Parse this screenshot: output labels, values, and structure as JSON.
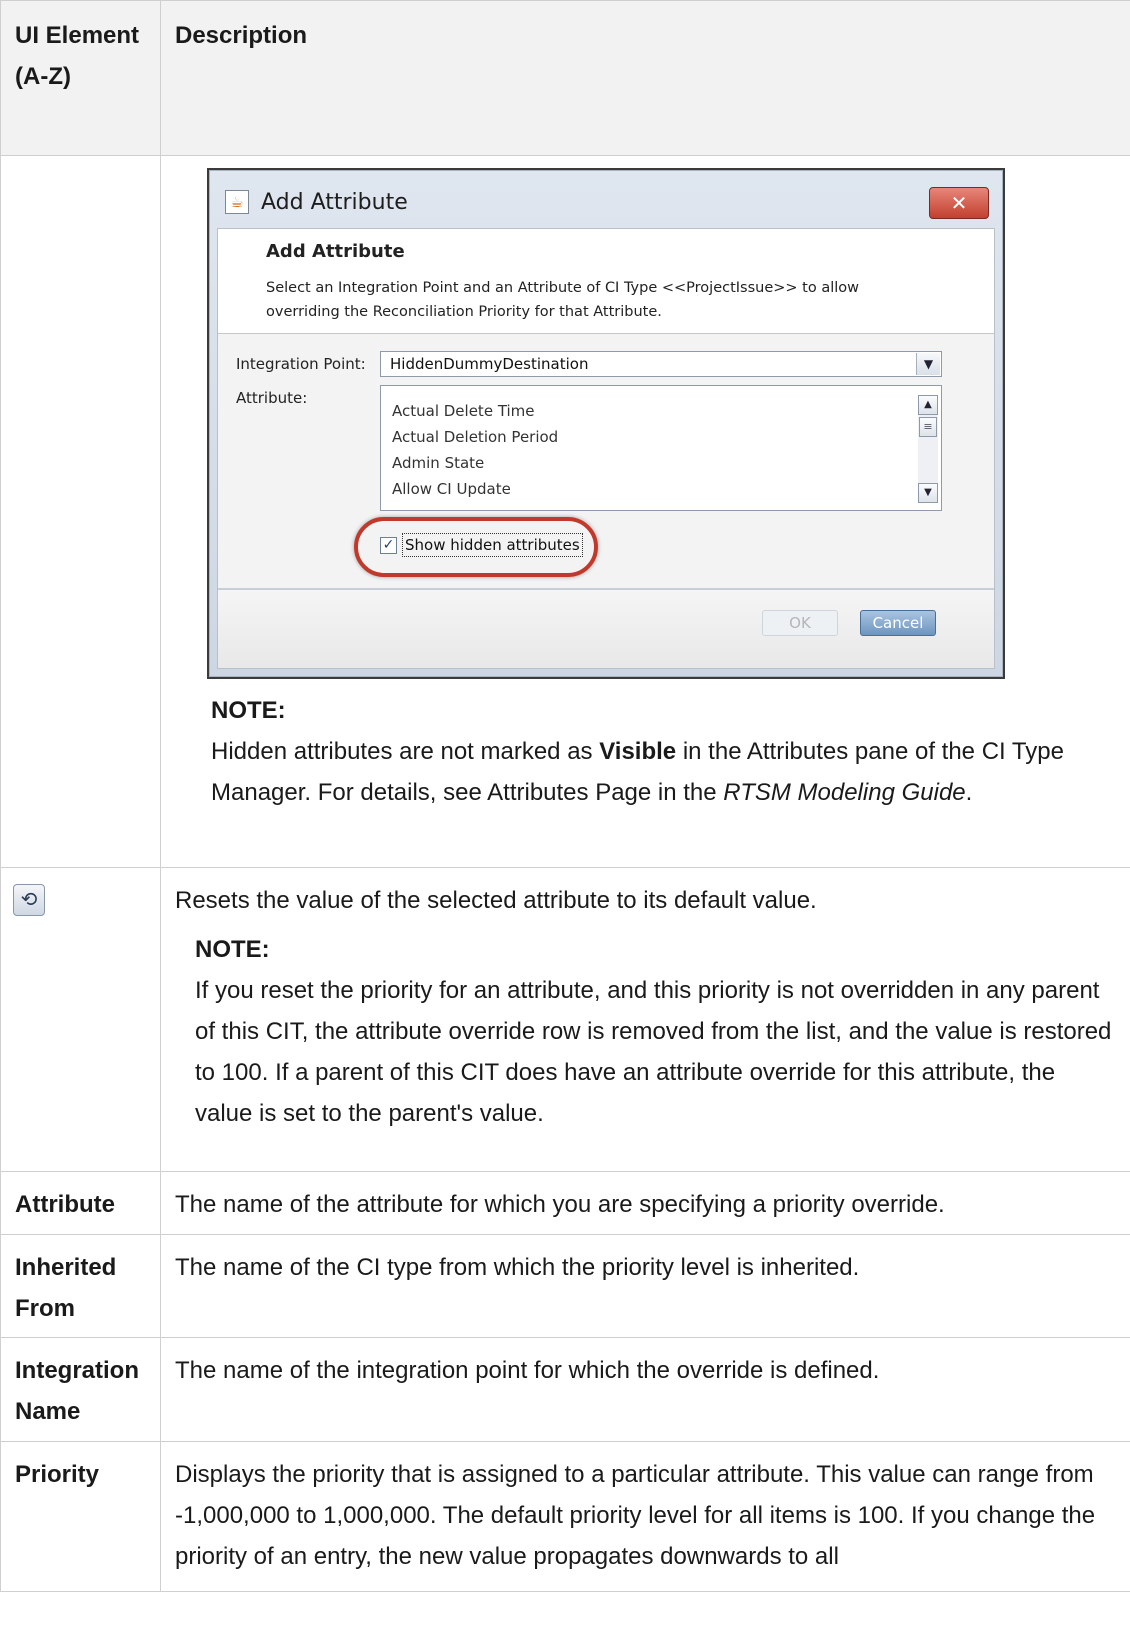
{
  "table": {
    "header": {
      "col1": "UI Element (A-Z)",
      "col2": "Description"
    }
  },
  "dialog": {
    "title": "Add Attribute",
    "close_label": "✕",
    "banner_title": "Add Attribute",
    "banner_text": "Select an Integration Point and an Attribute of CI Type <<ProjectIssue>> to allow overriding the Reconciliation Priority for that Attribute.",
    "integration_point_label": "Integration Point:",
    "integration_point_value": "HiddenDummyDestination",
    "attribute_label": "Attribute:",
    "attributes": [
      "Actual Delete Time",
      "Actual Deletion Period",
      "Admin State",
      "Allow CI Update"
    ],
    "show_hidden_label": "Show hidden attributes",
    "show_hidden_checked": true,
    "ok_label": "OK",
    "cancel_label": "Cancel"
  },
  "note1": {
    "heading": "NOTE:",
    "text_before_bold": "Hidden attributes are not marked as ",
    "bold": "Visible",
    "text_mid": " in the Attributes pane of the CI Type Manager. For details, see Attributes Page in the ",
    "italic_1": "RTSM Modeling",
    "italic_2": "Guide",
    "text_end": "."
  },
  "rows": [
    {
      "label": "",
      "icon": "reset-icon",
      "description": "Resets the value of the selected attribute to its default value.",
      "note_heading": "NOTE:",
      "note_text": "If you reset the priority for an attribute, and this priority is not overridden in any parent of this CIT, the attribute override row is removed from the list, and the value is restored to 100. If a parent of this CIT does have an attribute override for this attribute, the value is set to the parent's value."
    },
    {
      "label": "Attribute",
      "description": "The name of the attribute for which you are specifying a priority override."
    },
    {
      "label": "Inherited From",
      "description": "The name of the CI type from which the priority level is inherited."
    },
    {
      "label": "Integration Name",
      "description": "The name of the integration point for which the override is defined."
    },
    {
      "label": "Priority",
      "description": "Displays the priority that is assigned to a particular attribute. This value can range from -1,000,000 to 1,000,000. The default priority level for all items is 100. If you change the priority of an entry, the new value propagates downwards to all"
    }
  ]
}
